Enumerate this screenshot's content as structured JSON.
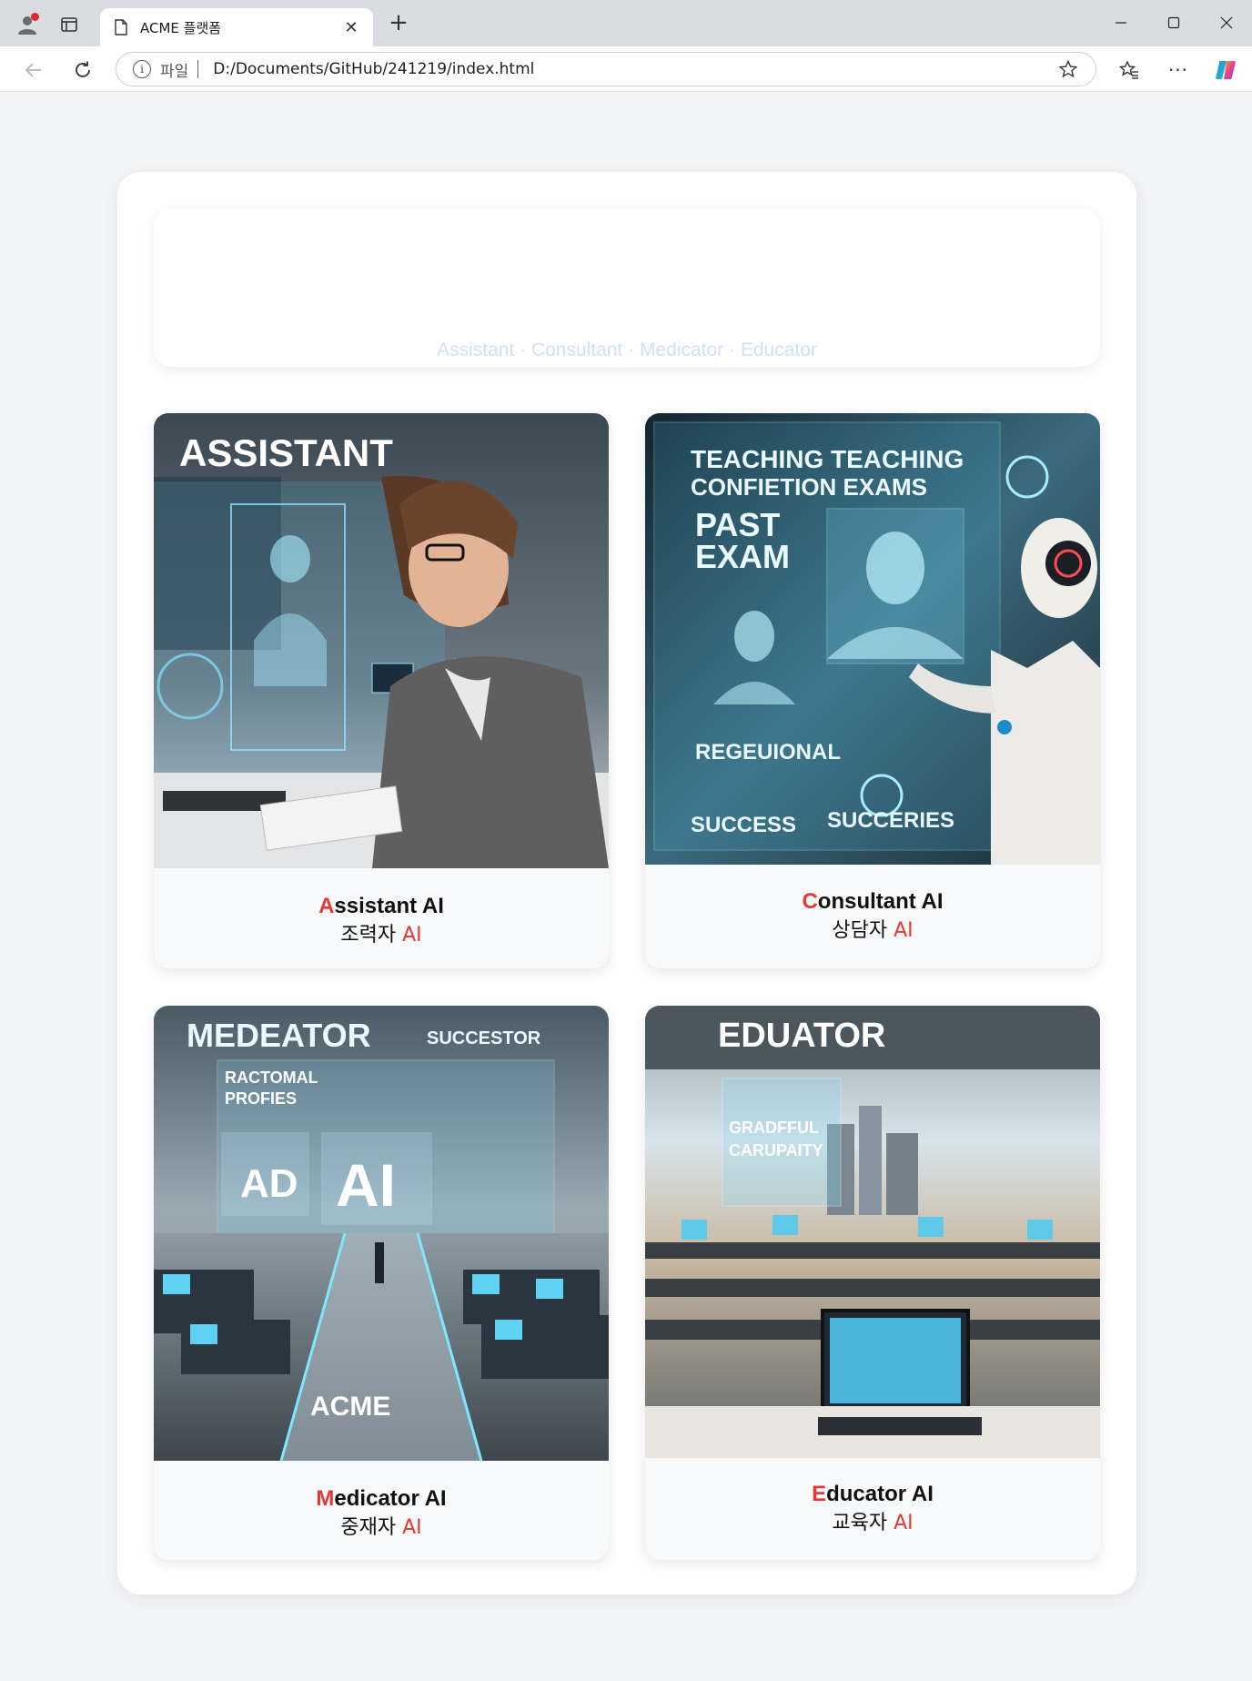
{
  "browser": {
    "tab_title": "ACME 플랫폼",
    "address_label": "파일",
    "url": "D:/Documents/GitHub/241219/index.html"
  },
  "hero": {
    "subtitle": "Assistant · Consultant · Medicator · Educator"
  },
  "cards": [
    {
      "title_first": "A",
      "title_rest": "ssistant AI",
      "subtitle_ko": "조력자 ",
      "subtitle_ai": "AI",
      "image_text": [
        "ASSISTANT"
      ]
    },
    {
      "title_first": "C",
      "title_rest": "onsultant AI",
      "subtitle_ko": "상담자 ",
      "subtitle_ai": "AI",
      "image_text": [
        "TEACHING TEACHING",
        "CONFIETION EXAMS",
        "PAST",
        "EXAM",
        "REGEUIONAL",
        "SUCCESS",
        "SUCCERIES"
      ]
    },
    {
      "title_first": "M",
      "title_rest": "edicator AI",
      "subtitle_ko": "중재자 ",
      "subtitle_ai": "AI",
      "image_text": [
        "MEDEATOR",
        "SUCCESTOR",
        "RACTOMAL",
        "PROFIES",
        "AD",
        "AI",
        "ACME"
      ]
    },
    {
      "title_first": "E",
      "title_rest": "ducator AI",
      "subtitle_ko": "교육자 ",
      "subtitle_ai": "AI",
      "image_text": [
        "EDUATOR",
        "GRADFFUL",
        "CARUPAITY"
      ]
    }
  ],
  "colors": {
    "accent": "#e53935",
    "subtitle": "#cfe0fb",
    "page_bg": "#f3f4f6"
  },
  "icons": {
    "profile": "profile-icon",
    "tabs": "tab-actions-icon",
    "page": "page-icon",
    "close": "close-icon",
    "new_tab": "plus-icon",
    "back": "back-arrow-icon",
    "reload": "reload-icon",
    "info": "info-icon",
    "favorite": "star-icon",
    "favorites": "favorites-icon",
    "more": "more-icon",
    "copilot": "copilot-icon"
  }
}
